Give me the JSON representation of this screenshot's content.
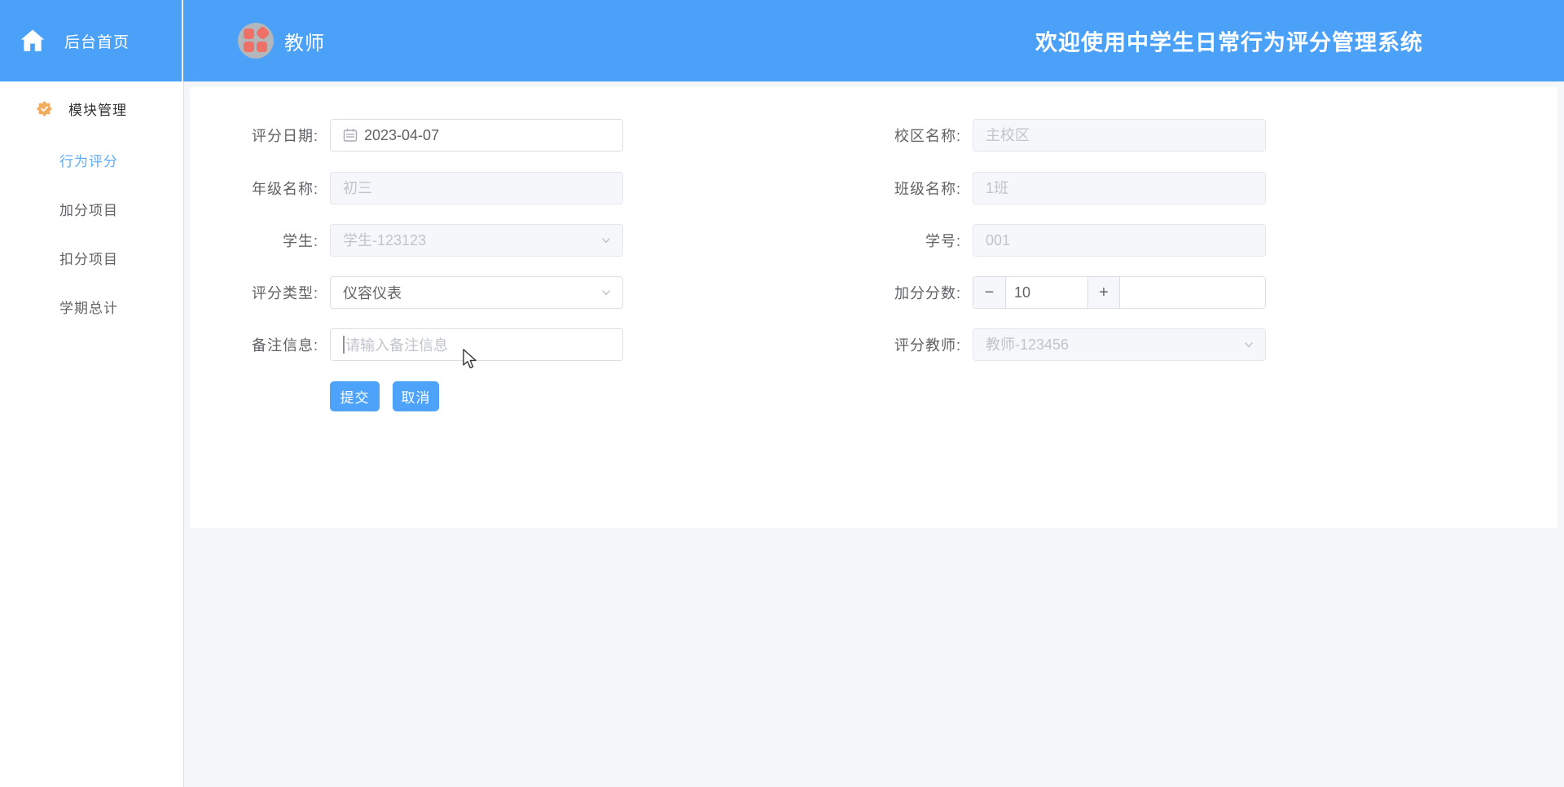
{
  "header": {
    "home_label": "后台首页",
    "brand": "教师",
    "welcome_title": "欢迎使用中学生日常行为评分管理系统"
  },
  "sidebar": {
    "section_label": "模块管理",
    "items": [
      {
        "label": "行为评分",
        "active": true
      },
      {
        "label": "加分项目",
        "active": false
      },
      {
        "label": "扣分项目",
        "active": false
      },
      {
        "label": "学期总计",
        "active": false
      }
    ]
  },
  "form": {
    "score_date": {
      "label": "评分日期:",
      "value": "2023-04-07"
    },
    "campus": {
      "label": "校区名称:",
      "placeholder": "主校区"
    },
    "grade": {
      "label": "年级名称:",
      "placeholder": "初三"
    },
    "clazz": {
      "label": "班级名称:",
      "placeholder": "1班"
    },
    "student": {
      "label": "学生:",
      "placeholder": "学生-123123"
    },
    "student_no": {
      "label": "学号:",
      "placeholder": "001"
    },
    "score_type": {
      "label": "评分类型:",
      "value": "仪容仪表"
    },
    "add_score": {
      "label": "加分分数:",
      "value": "10",
      "minus": "−",
      "plus": "+"
    },
    "remark": {
      "label": "备注信息:",
      "placeholder": "请输入备注信息"
    },
    "teacher": {
      "label": "评分教师:",
      "placeholder": "教师-123456"
    },
    "submit_label": "提交",
    "cancel_label": "取消"
  },
  "icons": {
    "home": "home-icon",
    "module_badge": "badge-check-icon",
    "logo": "four-petal-logo",
    "calendar": "calendar-icon",
    "chevron": "chevron-down-icon",
    "minus": "minus-icon",
    "plus": "plus-icon",
    "cursor": "mouse-cursor"
  },
  "colors": {
    "header_blue": "#4ba1f8",
    "active_item_blue": "#60acf9",
    "button_blue": "#4da2f9",
    "logo_coral": "#ee7066",
    "logo_circle_gray": "#b3b7bc",
    "badge_orange": "#f0ad60",
    "page_gray": "#f5f6f7",
    "disabled_bg": "#f5f7fa",
    "border_gray": "#dcdfe6",
    "placeholder_gray": "#c0c4cc",
    "text_gray": "#606266"
  }
}
